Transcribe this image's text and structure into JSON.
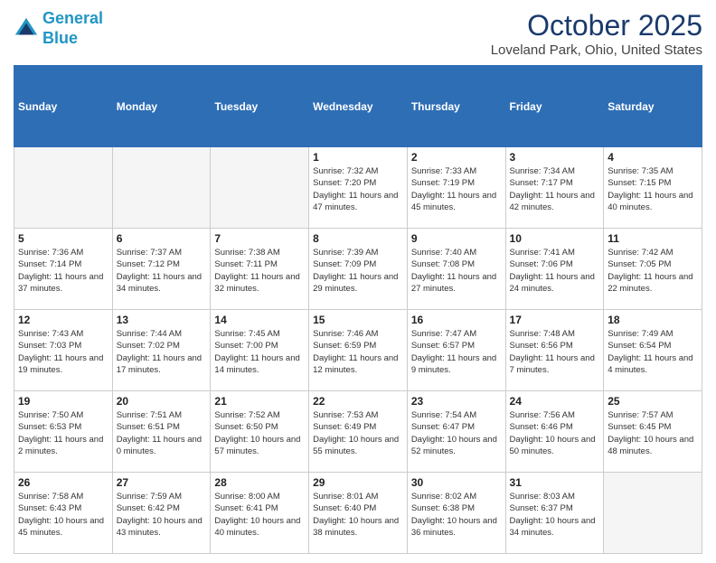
{
  "header": {
    "logo_line1": "General",
    "logo_line2": "Blue",
    "month": "October 2025",
    "location": "Loveland Park, Ohio, United States"
  },
  "days_of_week": [
    "Sunday",
    "Monday",
    "Tuesday",
    "Wednesday",
    "Thursday",
    "Friday",
    "Saturday"
  ],
  "weeks": [
    [
      {
        "num": "",
        "info": ""
      },
      {
        "num": "",
        "info": ""
      },
      {
        "num": "",
        "info": ""
      },
      {
        "num": "1",
        "info": "Sunrise: 7:32 AM\nSunset: 7:20 PM\nDaylight: 11 hours and 47 minutes."
      },
      {
        "num": "2",
        "info": "Sunrise: 7:33 AM\nSunset: 7:19 PM\nDaylight: 11 hours and 45 minutes."
      },
      {
        "num": "3",
        "info": "Sunrise: 7:34 AM\nSunset: 7:17 PM\nDaylight: 11 hours and 42 minutes."
      },
      {
        "num": "4",
        "info": "Sunrise: 7:35 AM\nSunset: 7:15 PM\nDaylight: 11 hours and 40 minutes."
      }
    ],
    [
      {
        "num": "5",
        "info": "Sunrise: 7:36 AM\nSunset: 7:14 PM\nDaylight: 11 hours and 37 minutes."
      },
      {
        "num": "6",
        "info": "Sunrise: 7:37 AM\nSunset: 7:12 PM\nDaylight: 11 hours and 34 minutes."
      },
      {
        "num": "7",
        "info": "Sunrise: 7:38 AM\nSunset: 7:11 PM\nDaylight: 11 hours and 32 minutes."
      },
      {
        "num": "8",
        "info": "Sunrise: 7:39 AM\nSunset: 7:09 PM\nDaylight: 11 hours and 29 minutes."
      },
      {
        "num": "9",
        "info": "Sunrise: 7:40 AM\nSunset: 7:08 PM\nDaylight: 11 hours and 27 minutes."
      },
      {
        "num": "10",
        "info": "Sunrise: 7:41 AM\nSunset: 7:06 PM\nDaylight: 11 hours and 24 minutes."
      },
      {
        "num": "11",
        "info": "Sunrise: 7:42 AM\nSunset: 7:05 PM\nDaylight: 11 hours and 22 minutes."
      }
    ],
    [
      {
        "num": "12",
        "info": "Sunrise: 7:43 AM\nSunset: 7:03 PM\nDaylight: 11 hours and 19 minutes."
      },
      {
        "num": "13",
        "info": "Sunrise: 7:44 AM\nSunset: 7:02 PM\nDaylight: 11 hours and 17 minutes."
      },
      {
        "num": "14",
        "info": "Sunrise: 7:45 AM\nSunset: 7:00 PM\nDaylight: 11 hours and 14 minutes."
      },
      {
        "num": "15",
        "info": "Sunrise: 7:46 AM\nSunset: 6:59 PM\nDaylight: 11 hours and 12 minutes."
      },
      {
        "num": "16",
        "info": "Sunrise: 7:47 AM\nSunset: 6:57 PM\nDaylight: 11 hours and 9 minutes."
      },
      {
        "num": "17",
        "info": "Sunrise: 7:48 AM\nSunset: 6:56 PM\nDaylight: 11 hours and 7 minutes."
      },
      {
        "num": "18",
        "info": "Sunrise: 7:49 AM\nSunset: 6:54 PM\nDaylight: 11 hours and 4 minutes."
      }
    ],
    [
      {
        "num": "19",
        "info": "Sunrise: 7:50 AM\nSunset: 6:53 PM\nDaylight: 11 hours and 2 minutes."
      },
      {
        "num": "20",
        "info": "Sunrise: 7:51 AM\nSunset: 6:51 PM\nDaylight: 11 hours and 0 minutes."
      },
      {
        "num": "21",
        "info": "Sunrise: 7:52 AM\nSunset: 6:50 PM\nDaylight: 10 hours and 57 minutes."
      },
      {
        "num": "22",
        "info": "Sunrise: 7:53 AM\nSunset: 6:49 PM\nDaylight: 10 hours and 55 minutes."
      },
      {
        "num": "23",
        "info": "Sunrise: 7:54 AM\nSunset: 6:47 PM\nDaylight: 10 hours and 52 minutes."
      },
      {
        "num": "24",
        "info": "Sunrise: 7:56 AM\nSunset: 6:46 PM\nDaylight: 10 hours and 50 minutes."
      },
      {
        "num": "25",
        "info": "Sunrise: 7:57 AM\nSunset: 6:45 PM\nDaylight: 10 hours and 48 minutes."
      }
    ],
    [
      {
        "num": "26",
        "info": "Sunrise: 7:58 AM\nSunset: 6:43 PM\nDaylight: 10 hours and 45 minutes."
      },
      {
        "num": "27",
        "info": "Sunrise: 7:59 AM\nSunset: 6:42 PM\nDaylight: 10 hours and 43 minutes."
      },
      {
        "num": "28",
        "info": "Sunrise: 8:00 AM\nSunset: 6:41 PM\nDaylight: 10 hours and 40 minutes."
      },
      {
        "num": "29",
        "info": "Sunrise: 8:01 AM\nSunset: 6:40 PM\nDaylight: 10 hours and 38 minutes."
      },
      {
        "num": "30",
        "info": "Sunrise: 8:02 AM\nSunset: 6:38 PM\nDaylight: 10 hours and 36 minutes."
      },
      {
        "num": "31",
        "info": "Sunrise: 8:03 AM\nSunset: 6:37 PM\nDaylight: 10 hours and 34 minutes."
      },
      {
        "num": "",
        "info": ""
      }
    ]
  ]
}
